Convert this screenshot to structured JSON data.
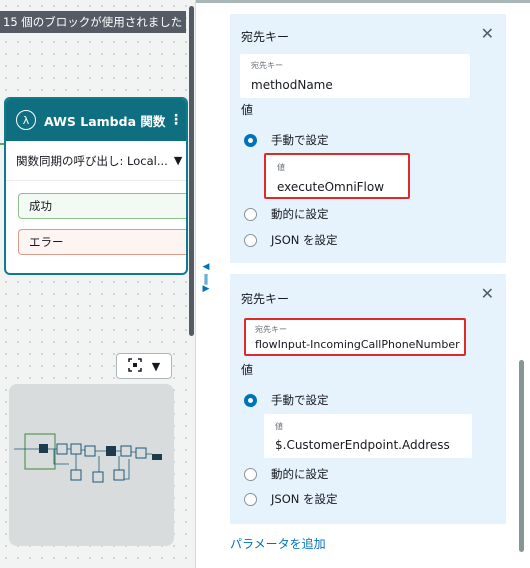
{
  "canvas": {
    "block_count": "15 個のブロックが使用されました",
    "lambda": {
      "icon_glyph": "λ",
      "title": "AWS Lambda 関数",
      "function": "関数同期の呼び出し: Local...",
      "branches": [
        "成功",
        "エラー"
      ]
    }
  },
  "attributes": [
    {
      "dest_key_label": "宛先キー",
      "dest_key_small": "宛先キー",
      "dest_key_value": "methodName",
      "value_label": "値",
      "radio_manual": "手動で設定",
      "value_small": "値",
      "value_value": "executeOmniFlow",
      "radio_dynamic": "動的に設定",
      "radio_json": "JSON を設定"
    },
    {
      "dest_key_label": "宛先キー",
      "dest_key_small": "宛先キー",
      "dest_key_value": "flowInput-IncomingCallPhoneNumber",
      "value_label": "値",
      "radio_manual": "手動で設定",
      "value_small": "値",
      "value_value": "$.CustomerEndpoint.Address",
      "radio_dynamic": "動的に設定",
      "radio_json": "JSON を設定"
    }
  ],
  "add_parameter": "パラメータを追加",
  "colors": {
    "lambda_header": "#0f6f80",
    "panel_bg": "#e6f2fc",
    "accent": "#0073bb",
    "highlight": "#e02a2a"
  }
}
